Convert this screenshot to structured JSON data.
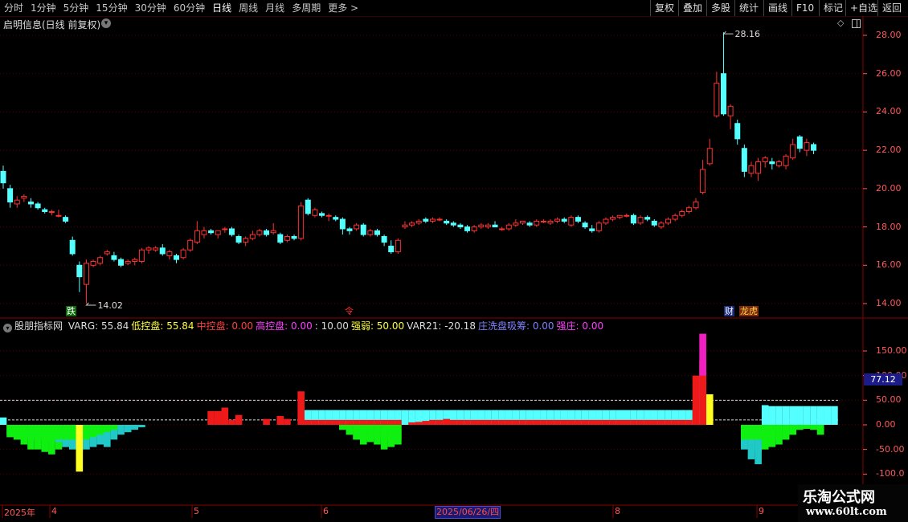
{
  "toolbar": {
    "periods": [
      "分时",
      "1分钟",
      "5分钟",
      "15分钟",
      "30分钟",
      "60分钟",
      "日线",
      "周线",
      "月线",
      "多周期",
      "更多 >"
    ],
    "active_period": "日线",
    "right_buttons": [
      "复权",
      "叠加",
      "多股",
      "统计",
      "画线",
      "F10",
      "标记",
      "+自选",
      "返回"
    ]
  },
  "main_chart": {
    "title": "启明信息(日线 前复权)",
    "high_label": "28.16",
    "low_label": "14.02",
    "y_ticks": [
      "28.00",
      "26.00",
      "24.00",
      "22.00",
      "20.00",
      "18.00",
      "16.00",
      "14.00"
    ],
    "markers": [
      {
        "text": "跌",
        "color": "#ffffff",
        "bg": "#0a6a0a"
      },
      {
        "text": "令",
        "color": "#ff3030",
        "bg": "transparent"
      },
      {
        "text": "财",
        "color": "#ffffff",
        "bg": "#1a2a7a"
      },
      {
        "text": "龙虎",
        "color": "#ffd040",
        "bg": "#7a2a10"
      }
    ]
  },
  "indicator": {
    "name": "股朋指标网",
    "items": [
      {
        "label": "VARG:",
        "value": "55.84",
        "color": "#dddddd"
      },
      {
        "label": "低控盘:",
        "value": "55.84",
        "color": "#ffff40"
      },
      {
        "label": "中控盘:",
        "value": "0.00",
        "color": "#ff4040"
      },
      {
        "label": "高控盘:",
        "value": "0.00",
        "color": "#ff40ff"
      },
      {
        "label": ":",
        "value": "10.00",
        "color": "#dddddd"
      },
      {
        "label": "强弱:",
        "value": "50.00",
        "color": "#ffff40"
      },
      {
        "label": "VAR21:",
        "value": "-20.18",
        "color": "#dddddd"
      },
      {
        "label": "庄洗盘吸筹:",
        "value": "0.00",
        "color": "#8080ff"
      },
      {
        "label": "强庄:",
        "value": "0.00",
        "color": "#ff40ff"
      }
    ],
    "y_ticks": [
      "150.00",
      "100.00",
      "50.00",
      "0.00",
      "-50.00",
      "-100.0"
    ],
    "current_value": "77.12"
  },
  "date_axis": {
    "ticks": [
      "2025年",
      "4",
      "5",
      "6",
      "8",
      "9"
    ],
    "cursor_date": "2025/06/26/四"
  },
  "colors": {
    "up": "#ff3232",
    "down": "#54ffff",
    "grid": "#5a0000",
    "axis": "#ff5a5a"
  },
  "watermark": {
    "line1": "乐淘公式网",
    "line2": "www.60lt.com"
  },
  "chart_data": {
    "type": "candlestick",
    "y_range": [
      13.5,
      28.5
    ],
    "candles": [
      [
        20.9,
        21.2,
        20.0,
        20.3
      ],
      [
        20.0,
        20.2,
        19.0,
        19.3
      ],
      [
        19.2,
        19.6,
        19.0,
        19.4
      ],
      [
        19.5,
        19.7,
        19.3,
        19.6
      ],
      [
        19.3,
        19.5,
        19.0,
        19.2
      ],
      [
        19.2,
        19.3,
        18.9,
        19.0
      ],
      [
        18.9,
        19.0,
        18.7,
        18.8
      ],
      [
        18.8,
        18.9,
        18.6,
        18.8
      ],
      [
        18.6,
        18.9,
        18.5,
        18.6
      ],
      [
        18.5,
        18.6,
        18.2,
        18.3
      ],
      [
        17.3,
        17.5,
        16.5,
        16.6
      ],
      [
        16.0,
        16.2,
        14.6,
        15.4
      ],
      [
        15.0,
        16.3,
        14.0,
        16.1
      ],
      [
        16.0,
        16.3,
        15.9,
        16.2
      ],
      [
        16.1,
        16.5,
        16.0,
        16.4
      ],
      [
        16.6,
        16.8,
        16.5,
        16.7
      ],
      [
        16.5,
        16.7,
        16.2,
        16.3
      ],
      [
        16.3,
        16.4,
        15.9,
        16.0
      ],
      [
        16.1,
        16.3,
        16.0,
        16.2
      ],
      [
        16.2,
        16.4,
        16.0,
        16.3
      ],
      [
        16.2,
        16.9,
        16.1,
        16.8
      ],
      [
        16.8,
        17.0,
        16.6,
        16.9
      ],
      [
        16.8,
        17.0,
        16.7,
        16.9
      ],
      [
        16.9,
        17.1,
        16.5,
        16.6
      ],
      [
        16.5,
        16.8,
        16.3,
        16.7
      ],
      [
        16.5,
        16.6,
        16.1,
        16.3
      ],
      [
        16.4,
        16.9,
        16.3,
        16.8
      ],
      [
        16.8,
        17.4,
        16.7,
        17.3
      ],
      [
        17.2,
        18.3,
        17.1,
        17.8
      ],
      [
        17.6,
        18.0,
        17.4,
        17.8
      ],
      [
        17.8,
        17.9,
        17.6,
        17.7
      ],
      [
        17.6,
        17.8,
        17.4,
        17.8
      ],
      [
        17.9,
        18.0,
        17.7,
        17.9
      ],
      [
        17.9,
        18.0,
        17.5,
        17.6
      ],
      [
        17.5,
        17.6,
        17.1,
        17.2
      ],
      [
        17.2,
        17.5,
        17.0,
        17.4
      ],
      [
        17.4,
        17.8,
        17.3,
        17.6
      ],
      [
        17.6,
        17.9,
        17.5,
        17.8
      ],
      [
        17.8,
        17.9,
        17.5,
        17.6
      ],
      [
        17.7,
        18.2,
        17.6,
        17.8
      ],
      [
        17.6,
        17.7,
        17.1,
        17.2
      ],
      [
        17.3,
        17.6,
        17.2,
        17.5
      ],
      [
        17.5,
        17.6,
        17.3,
        17.4
      ],
      [
        17.4,
        19.3,
        17.3,
        19.1
      ],
      [
        19.4,
        19.5,
        18.6,
        18.7
      ],
      [
        18.6,
        19.0,
        18.5,
        18.9
      ],
      [
        18.7,
        18.8,
        18.5,
        18.6
      ],
      [
        18.6,
        18.7,
        18.3,
        18.6
      ],
      [
        18.5,
        18.6,
        18.3,
        18.4
      ],
      [
        18.4,
        18.5,
        17.6,
        17.9
      ],
      [
        17.9,
        18.0,
        17.6,
        17.8
      ],
      [
        17.9,
        18.2,
        17.8,
        18.1
      ],
      [
        18.1,
        18.2,
        17.5,
        17.6
      ],
      [
        17.6,
        17.9,
        17.5,
        17.8
      ],
      [
        17.8,
        17.9,
        17.5,
        17.6
      ],
      [
        17.5,
        17.6,
        17.0,
        17.2
      ],
      [
        17.0,
        17.3,
        16.6,
        16.7
      ],
      [
        16.7,
        17.4,
        16.6,
        17.3
      ],
      [
        18.0,
        18.3,
        17.9,
        18.1
      ],
      [
        18.1,
        18.3,
        18.0,
        18.2
      ],
      [
        18.2,
        18.4,
        18.1,
        18.3
      ],
      [
        18.4,
        18.5,
        18.2,
        18.3
      ],
      [
        18.3,
        18.5,
        18.2,
        18.4
      ],
      [
        18.4,
        18.5,
        18.3,
        18.4
      ],
      [
        18.3,
        18.4,
        18.1,
        18.2
      ],
      [
        18.2,
        18.3,
        18.0,
        18.1
      ],
      [
        18.1,
        18.2,
        17.9,
        18.0
      ],
      [
        18.0,
        18.1,
        17.7,
        17.8
      ],
      [
        17.8,
        18.1,
        17.7,
        18.0
      ],
      [
        18.0,
        18.2,
        17.9,
        18.1
      ],
      [
        18.0,
        18.2,
        17.9,
        18.1
      ],
      [
        18.1,
        18.3,
        18.0,
        18.0
      ],
      [
        17.9,
        18.0,
        17.8,
        17.9
      ],
      [
        17.9,
        18.2,
        17.8,
        18.1
      ],
      [
        18.1,
        18.4,
        18.0,
        18.2
      ],
      [
        18.2,
        18.3,
        18.1,
        18.3
      ],
      [
        18.2,
        18.3,
        18.0,
        18.1
      ],
      [
        18.1,
        18.4,
        18.0,
        18.3
      ],
      [
        18.3,
        18.4,
        18.2,
        18.3
      ],
      [
        18.2,
        18.4,
        18.1,
        18.3
      ],
      [
        18.3,
        18.5,
        18.2,
        18.4
      ],
      [
        18.4,
        18.5,
        18.2,
        18.3
      ],
      [
        18.1,
        18.6,
        18.0,
        18.5
      ],
      [
        18.5,
        18.6,
        18.2,
        18.3
      ],
      [
        18.2,
        18.3,
        17.9,
        18.0
      ],
      [
        17.9,
        18.1,
        17.7,
        17.8
      ],
      [
        17.8,
        18.3,
        17.7,
        18.2
      ],
      [
        18.2,
        18.5,
        18.1,
        18.4
      ],
      [
        18.4,
        18.6,
        18.3,
        18.5
      ],
      [
        18.5,
        18.6,
        18.4,
        18.6
      ],
      [
        18.6,
        18.7,
        18.5,
        18.6
      ],
      [
        18.6,
        18.7,
        18.1,
        18.2
      ],
      [
        18.2,
        18.6,
        18.1,
        18.5
      ],
      [
        18.5,
        18.6,
        18.3,
        18.4
      ],
      [
        18.3,
        18.4,
        18.0,
        18.1
      ],
      [
        18.0,
        18.3,
        17.9,
        18.2
      ],
      [
        18.2,
        18.5,
        18.1,
        18.4
      ],
      [
        18.4,
        18.7,
        18.3,
        18.6
      ],
      [
        18.6,
        18.9,
        18.5,
        18.8
      ],
      [
        18.8,
        19.1,
        18.7,
        19.0
      ],
      [
        19.0,
        19.5,
        18.9,
        19.3
      ],
      [
        19.8,
        21.5,
        19.7,
        21.0
      ],
      [
        21.3,
        22.6,
        21.2,
        22.1
      ],
      [
        23.8,
        26.1,
        23.7,
        25.5
      ],
      [
        26.0,
        28.16,
        23.8,
        23.9
      ],
      [
        23.8,
        24.4,
        23.1,
        24.3
      ],
      [
        23.4,
        23.6,
        22.3,
        22.6
      ],
      [
        22.1,
        22.3,
        20.6,
        20.9
      ],
      [
        20.8,
        21.4,
        20.6,
        21.2
      ],
      [
        20.8,
        21.6,
        20.4,
        21.4
      ],
      [
        21.4,
        21.7,
        21.1,
        21.6
      ],
      [
        21.4,
        21.6,
        21.0,
        21.3
      ],
      [
        21.2,
        21.5,
        21.1,
        21.4
      ],
      [
        21.2,
        21.8,
        21.0,
        21.7
      ],
      [
        21.6,
        22.6,
        21.5,
        22.3
      ],
      [
        22.7,
        22.8,
        21.9,
        22.1
      ],
      [
        22.0,
        22.6,
        21.7,
        22.4
      ],
      [
        22.3,
        22.4,
        21.8,
        22.0
      ]
    ],
    "indicator_series": {
      "cyan_bars": [
        15,
        -20,
        -28,
        -25,
        -25,
        -27,
        -22,
        -25,
        -35,
        -45,
        -50,
        -55,
        -50,
        -45,
        -40,
        -45,
        -30,
        -20,
        -15,
        -10,
        -5,
        0,
        0,
        0,
        0,
        0,
        0,
        0,
        0,
        0,
        0,
        0,
        0,
        0,
        0,
        0,
        0,
        0,
        0,
        0,
        0,
        0,
        0,
        0,
        30,
        30,
        30,
        30,
        30,
        30,
        30,
        30,
        30,
        30,
        30,
        30,
        30,
        30,
        30,
        30,
        30,
        30,
        30,
        30,
        30,
        30,
        30,
        30,
        30,
        30,
        30,
        30,
        30,
        30,
        30,
        30,
        30,
        30,
        30,
        30,
        30,
        30,
        30,
        30,
        30,
        30,
        30,
        30,
        30,
        30,
        30,
        30,
        30,
        30,
        30,
        30,
        30,
        30,
        30,
        30,
        30,
        30,
        0,
        0,
        0,
        0,
        0,
        -50,
        -70,
        -80,
        40,
        38,
        38,
        38,
        38,
        38,
        38,
        38,
        38,
        38,
        38
      ],
      "red_bars": [
        0,
        0,
        0,
        0,
        0,
        0,
        0,
        0,
        0,
        0,
        0,
        0,
        0,
        0,
        0,
        0,
        0,
        0,
        0,
        0,
        0,
        0,
        0,
        0,
        0,
        0,
        0,
        0,
        0,
        0,
        28,
        28,
        35,
        10,
        20,
        0,
        0,
        0,
        12,
        0,
        18,
        12,
        0,
        68,
        10,
        10,
        10,
        10,
        10,
        10,
        10,
        10,
        10,
        10,
        10,
        10,
        10,
        10,
        0,
        5,
        6,
        8,
        10,
        10,
        12,
        10,
        10,
        10,
        10,
        10,
        10,
        10,
        10,
        10,
        10,
        10,
        10,
        10,
        10,
        10,
        10,
        10,
        10,
        10,
        10,
        10,
        10,
        10,
        10,
        10,
        10,
        10,
        10,
        10,
        10,
        10,
        10,
        10,
        10,
        10,
        100,
        100,
        50,
        0,
        0,
        0,
        0,
        0,
        0,
        0,
        0,
        0,
        0,
        0,
        0,
        0,
        0,
        0,
        0,
        0,
        0
      ],
      "green_bars": [
        0,
        -25,
        -30,
        -40,
        -50,
        -50,
        -55,
        -60,
        -50,
        -45,
        -40,
        -35,
        -30,
        -25,
        -20,
        -15,
        -10,
        0,
        0,
        0,
        0,
        0,
        0,
        0,
        0,
        0,
        0,
        0,
        0,
        0,
        0,
        0,
        0,
        0,
        0,
        0,
        0,
        0,
        0,
        0,
        0,
        0,
        0,
        0,
        0,
        0,
        0,
        0,
        0,
        -10,
        -20,
        -30,
        -40,
        -35,
        -40,
        -50,
        -45,
        -40,
        0,
        0,
        0,
        0,
        0,
        0,
        0,
        0,
        0,
        0,
        0,
        0,
        0,
        0,
        0,
        0,
        0,
        0,
        0,
        0,
        0,
        0,
        0,
        0,
        0,
        0,
        0,
        0,
        0,
        0,
        0,
        0,
        0,
        0,
        0,
        0,
        0,
        0,
        0,
        0,
        0,
        0,
        0,
        0,
        0,
        0,
        0,
        0,
        0,
        -40,
        -50,
        -55,
        -50,
        -45,
        -40,
        -30,
        -20,
        -10,
        -8,
        -10,
        -20,
        0,
        0
      ],
      "yellow_bars": [
        0,
        0,
        0,
        0,
        0,
        0,
        0,
        0,
        0,
        0,
        0,
        -95,
        0,
        0,
        0,
        0,
        0,
        0,
        0,
        0,
        0,
        0,
        0,
        0,
        0,
        0,
        0,
        0,
        0,
        0,
        0,
        0,
        0,
        0,
        0,
        0,
        0,
        0,
        0,
        0,
        0,
        0,
        0,
        0,
        0,
        0,
        0,
        0,
        0,
        0,
        0,
        0,
        0,
        0,
        0,
        0,
        0,
        0,
        0,
        0,
        0,
        0,
        0,
        0,
        0,
        0,
        0,
        0,
        0,
        0,
        0,
        0,
        0,
        0,
        0,
        0,
        0,
        0,
        0,
        0,
        0,
        0,
        0,
        0,
        0,
        0,
        0,
        0,
        0,
        0,
        0,
        0,
        0,
        0,
        0,
        0,
        0,
        0,
        0,
        0,
        0,
        0,
        62,
        0,
        0,
        0,
        0,
        0,
        0,
        0,
        0,
        0,
        0,
        0,
        0,
        0,
        0,
        0,
        0,
        0,
        0
      ],
      "magenta_bars": [
        0,
        0,
        0,
        0,
        0,
        0,
        0,
        0,
        0,
        0,
        0,
        0,
        0,
        0,
        0,
        0,
        0,
        0,
        0,
        0,
        0,
        0,
        0,
        0,
        0,
        0,
        0,
        0,
        0,
        0,
        0,
        0,
        0,
        0,
        0,
        0,
        0,
        0,
        0,
        0,
        0,
        0,
        0,
        0,
        0,
        0,
        0,
        0,
        0,
        0,
        0,
        0,
        0,
        0,
        0,
        0,
        0,
        0,
        0,
        0,
        0,
        0,
        0,
        0,
        0,
        0,
        0,
        0,
        0,
        0,
        0,
        0,
        0,
        0,
        0,
        0,
        0,
        0,
        0,
        0,
        0,
        0,
        0,
        0,
        0,
        0,
        0,
        0,
        0,
        0,
        0,
        0,
        0,
        0,
        0,
        0,
        0,
        0,
        0,
        0,
        0,
        185,
        0,
        0,
        0,
        0,
        0,
        0,
        0,
        0,
        0,
        0,
        0,
        0,
        0,
        0,
        0,
        0,
        0,
        0,
        0
      ],
      "guide_lines": [
        50,
        10
      ]
    }
  }
}
